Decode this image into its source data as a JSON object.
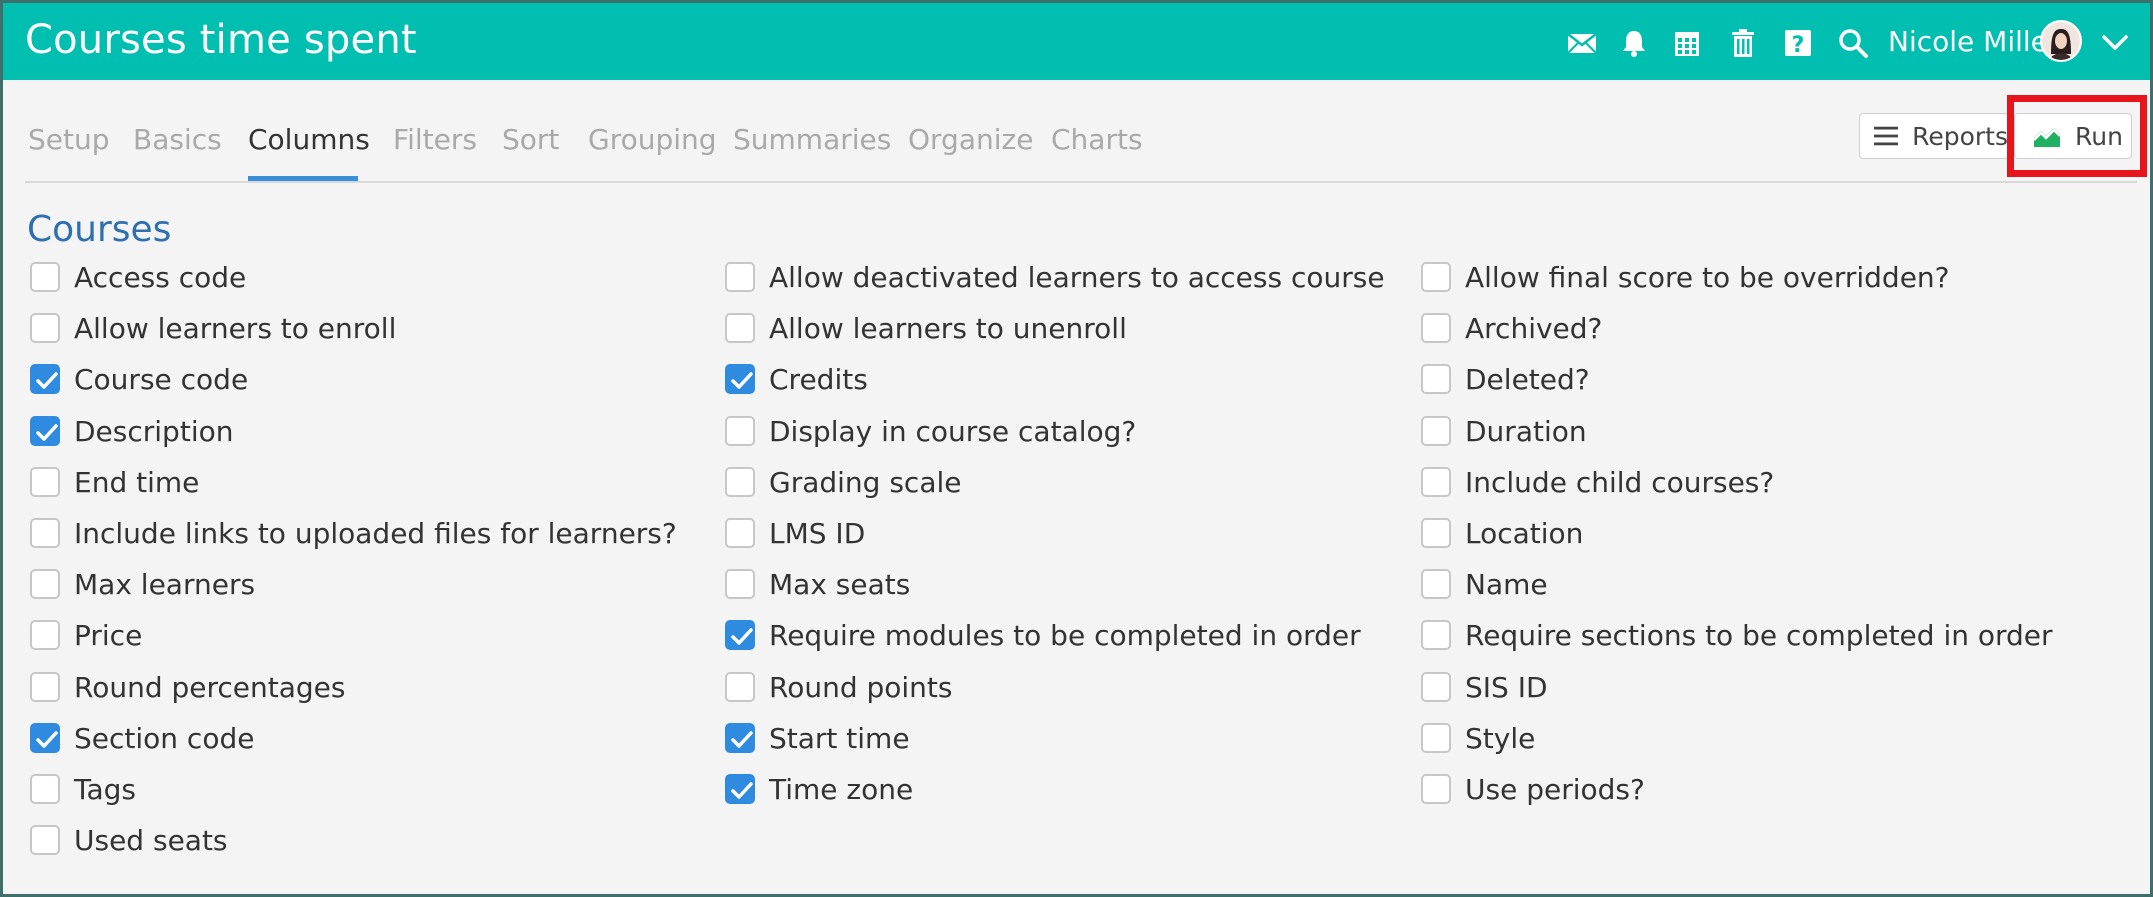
{
  "header": {
    "title": "Courses time spent",
    "user_name": "Nicole Miller",
    "icons": [
      "mail-icon",
      "bell-icon",
      "calendar-icon",
      "trash-icon",
      "help-icon",
      "search-icon"
    ]
  },
  "tabs": [
    {
      "label": "Setup",
      "active": false
    },
    {
      "label": "Basics",
      "active": false
    },
    {
      "label": "Columns",
      "active": true
    },
    {
      "label": "Filters",
      "active": false
    },
    {
      "label": "Sort",
      "active": false
    },
    {
      "label": "Grouping",
      "active": false
    },
    {
      "label": "Summaries",
      "active": false
    },
    {
      "label": "Organize",
      "active": false
    },
    {
      "label": "Charts",
      "active": false
    }
  ],
  "buttons": {
    "reports_label": "Reports",
    "run_label": "Run"
  },
  "section": {
    "title": "Courses",
    "columns": [
      [
        {
          "label": "Access code",
          "checked": false
        },
        {
          "label": "Allow learners to enroll",
          "checked": false
        },
        {
          "label": "Course code",
          "checked": true
        },
        {
          "label": "Description",
          "checked": true
        },
        {
          "label": "End time",
          "checked": false
        },
        {
          "label": "Include links to uploaded files for learners?",
          "checked": false
        },
        {
          "label": "Max learners",
          "checked": false
        },
        {
          "label": "Price",
          "checked": false
        },
        {
          "label": "Round percentages",
          "checked": false
        },
        {
          "label": "Section code",
          "checked": true
        },
        {
          "label": "Tags",
          "checked": false
        },
        {
          "label": "Used seats",
          "checked": false
        }
      ],
      [
        {
          "label": "Allow deactivated learners to access course",
          "checked": false
        },
        {
          "label": "Allow learners to unenroll",
          "checked": false
        },
        {
          "label": "Credits",
          "checked": true
        },
        {
          "label": "Display in course catalog?",
          "checked": false
        },
        {
          "label": "Grading scale",
          "checked": false
        },
        {
          "label": "LMS ID",
          "checked": false
        },
        {
          "label": "Max seats",
          "checked": false
        },
        {
          "label": "Require modules to be completed in order",
          "checked": true
        },
        {
          "label": "Round points",
          "checked": false
        },
        {
          "label": "Start time",
          "checked": true
        },
        {
          "label": "Time zone",
          "checked": true
        }
      ],
      [
        {
          "label": "Allow final score to be overridden?",
          "checked": false
        },
        {
          "label": "Archived?",
          "checked": false
        },
        {
          "label": "Deleted?",
          "checked": false
        },
        {
          "label": "Duration",
          "checked": false
        },
        {
          "label": "Include child courses?",
          "checked": false
        },
        {
          "label": "Location",
          "checked": false
        },
        {
          "label": "Name",
          "checked": false
        },
        {
          "label": "Require sections to be completed in order",
          "checked": false
        },
        {
          "label": "SIS ID",
          "checked": false
        },
        {
          "label": "Style",
          "checked": false
        },
        {
          "label": "Use periods?",
          "checked": false
        }
      ]
    ]
  },
  "colors": {
    "header": "#00bfb0",
    "accent": "#2f8be0",
    "section_title": "#2e6fb0",
    "highlight": "#e8141b"
  }
}
